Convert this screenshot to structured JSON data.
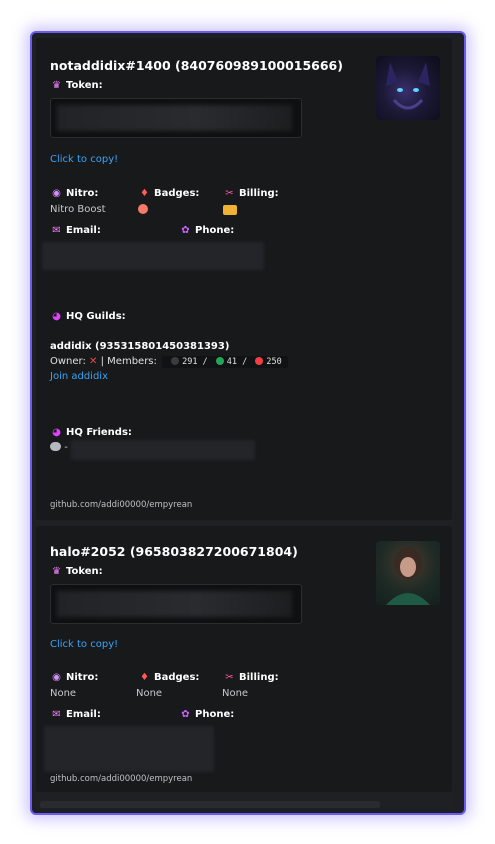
{
  "accounts": [
    {
      "title": "notaddidix#1400 (840760989100015666)",
      "token_label": "Token:",
      "copy_label": "Click to copy!",
      "nitro_label": "Nitro:",
      "nitro_value": "Nitro Boost",
      "badges_label": "Badges:",
      "billing_label": "Billing:",
      "email_label": "Email:",
      "phone_label": "Phone:",
      "hq_guilds_label": "HQ Guilds:",
      "guild": {
        "name": "addidix (935315801450381393)",
        "owner_label": "Owner:",
        "owner_value": "✕",
        "members_label": "| Members:",
        "count_total": "291",
        "count_online": "41",
        "count_dnd": "250",
        "join_label": "Join addidix"
      },
      "hq_friends_label": "HQ Friends:",
      "friends_prefix": "-",
      "footer": "github.com/addi00000/empyrean"
    },
    {
      "title": "halo#2052 (965803827200671804)",
      "token_label": "Token:",
      "copy_label": "Click to copy!",
      "nitro_label": "Nitro:",
      "nitro_value": "None",
      "badges_label": "Badges:",
      "badges_value": "None",
      "billing_label": "Billing:",
      "billing_value": "None",
      "email_label": "Email:",
      "phone_label": "Phone:",
      "footer": "github.com/addi00000/empyrean"
    }
  ],
  "icons": {
    "token": "crown-icon",
    "nitro": "nitro-icon",
    "badges": "badge-icon",
    "billing": "billing-icon",
    "email": "email-icon",
    "phone": "phone-icon",
    "guilds": "guild-icon",
    "friends": "friends-icon"
  },
  "colors": {
    "accent_border": "#6b5cf0",
    "link": "#3aa3f5",
    "status_offline": "#3b3c40",
    "status_online": "#23a55a",
    "status_dnd": "#f23f43"
  }
}
